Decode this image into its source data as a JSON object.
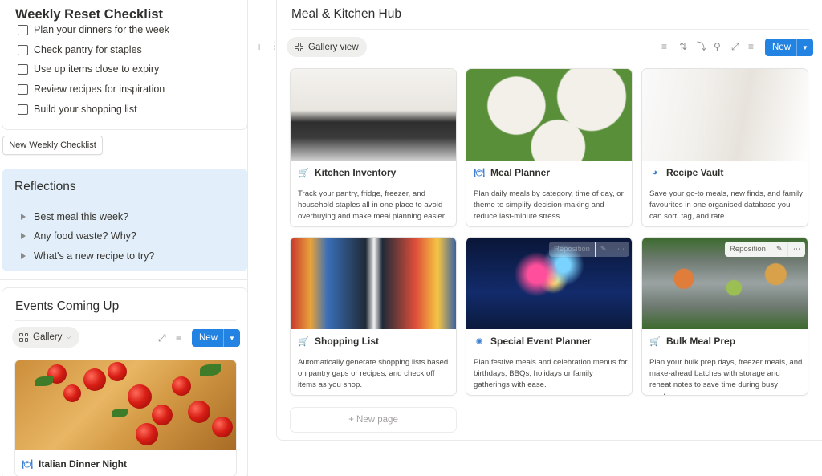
{
  "checklist": {
    "title": "Weekly Reset Checklist",
    "items": [
      "Plan your dinners for the week",
      "Check pantry for staples",
      "Use up items close to expiry",
      "Review recipes for inspiration",
      "Build your shopping list"
    ],
    "new_button": "New Weekly Checklist"
  },
  "reflections": {
    "title": "Reflections",
    "items": [
      "Best meal this week?",
      "Any food waste? Why?",
      "What's a new recipe to try?"
    ]
  },
  "events": {
    "title": "Events Coming Up",
    "view_label": "Gallery",
    "new_label": "New",
    "card_title": "Italian Dinner Night",
    "card_icon": "fork-knife-plate-icon"
  },
  "hub": {
    "title": "Meal & Kitchen Hub",
    "view_label": "Gallery view",
    "new_label": "New",
    "new_page_label": "+ New page",
    "cards": [
      {
        "title": "Kitchen Inventory",
        "icon": "basket-icon",
        "description": "Track your pantry, fridge, freezer, and household staples all in one place to avoid overbuying and make meal planning easier."
      },
      {
        "title": "Meal Planner",
        "icon": "fork-knife-plate-icon",
        "description": "Plan daily meals by category, time of day, or theme to simplify decision-making and reduce last-minute stress."
      },
      {
        "title": "Recipe Vault",
        "icon": "bowl-icon",
        "description": "Save your go-to meals, new finds, and family favourites in one organised database you can sort, tag, and rate."
      },
      {
        "title": "Shopping List",
        "icon": "cart-icon",
        "description": "Automatically generate shopping lists based on pantry gaps or recipes, and check off items as you shop."
      },
      {
        "title": "Special Event Planner",
        "icon": "sparkle-icon",
        "description": "Plan festive meals and celebration menus for birthdays, BBQs, holidays or family gatherings with ease."
      },
      {
        "title": "Bulk Meal Prep",
        "icon": "basket-icon",
        "description": "Plan your bulk prep days, freezer meals, and make-ahead batches with storage and reheat notes to save time during busy weeks."
      }
    ],
    "reposition_label": "Reposition"
  },
  "colors": {
    "accent": "#2383e2",
    "reflections_bg": "#e2eef9",
    "icon_blue": "#3d7fd0"
  }
}
